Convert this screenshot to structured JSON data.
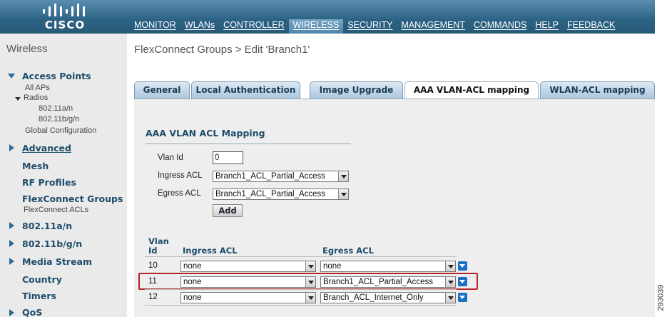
{
  "header": {
    "logo_text": "CISCO",
    "nav": [
      {
        "label": "MONITOR"
      },
      {
        "label": "WLANs"
      },
      {
        "label": "CONTROLLER"
      },
      {
        "label": "WIRELESS"
      },
      {
        "label": "SECURITY"
      },
      {
        "label": "MANAGEMENT"
      },
      {
        "label": "COMMANDS"
      },
      {
        "label": "HELP"
      },
      {
        "label": "FEEDBACK"
      }
    ],
    "active_nav": "WIRELESS"
  },
  "sidebar": {
    "title": "Wireless",
    "access_points": "Access Points",
    "all_aps": "All APs",
    "radios": "Radios",
    "radio_a": "802.11a/n",
    "radio_b": "802.11b/g/n",
    "global_config": "Global Configuration",
    "advanced": "Advanced",
    "mesh": "Mesh",
    "rf_profiles": "RF Profiles",
    "flexconnect_groups": "FlexConnect Groups",
    "flexconnect_acls": "FlexConnect ACLs",
    "band_a": "802.11a/n",
    "band_b": "802.11b/g/n",
    "media_stream": "Media Stream",
    "country": "Country",
    "timers": "Timers",
    "qos": "QoS"
  },
  "main": {
    "page_title": "FlexConnect Groups > Edit   'Branch1'",
    "tabs": [
      {
        "label": "General"
      },
      {
        "label": "Local Authentication"
      },
      {
        "label": "Image Upgrade"
      },
      {
        "label": "AAA VLAN-ACL mapping"
      },
      {
        "label": "WLAN-ACL mapping"
      }
    ],
    "active_tab": "AAA VLAN-ACL mapping",
    "section_title": "AAA VLAN ACL Mapping",
    "form": {
      "vlan_id_label": "Vlan Id",
      "vlan_id_value": "0",
      "ingress_label": "Ingress ACL",
      "ingress_value": "Branch1_ACL_Partial_Access",
      "egress_label": "Egress ACL",
      "egress_value": "Branch1_ACL_Partial_Access",
      "add_label": "Add"
    },
    "table": {
      "headers": {
        "vlan_line1": "Vlan",
        "vlan_line2": "Id",
        "ingress": "Ingress ACL",
        "egress": "Egress ACL"
      },
      "rows": [
        {
          "vlan_id": "10",
          "ingress": "none",
          "egress": "none"
        },
        {
          "vlan_id": "11",
          "ingress": "none",
          "egress": "Branch1_ACL_Partial_Access"
        },
        {
          "vlan_id": "12",
          "ingress": "none",
          "egress": "Branch_ACL_Internet_Only"
        }
      ],
      "highlighted_row": "11"
    }
  },
  "figure_id": "293039",
  "colors": {
    "header": "#2b6283",
    "accent_text": "#1e4d6b",
    "highlight_border": "#b3242b",
    "action_button": "#1c6fc4"
  }
}
